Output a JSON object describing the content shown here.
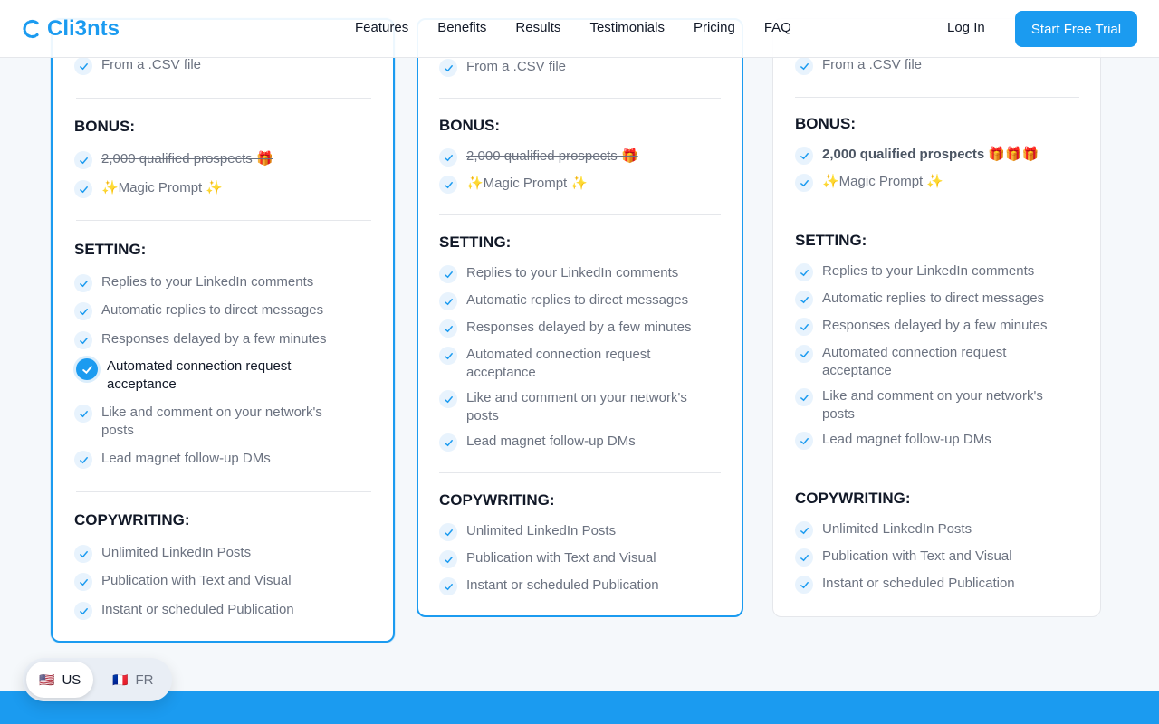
{
  "brand": {
    "name": "Cli3nts",
    "color": "#1b9bf0"
  },
  "nav": [
    "Features",
    "Benefits",
    "Results",
    "Testimonials",
    "Pricing",
    "FAQ"
  ],
  "header": {
    "login": "Log In",
    "cta": "Start Free Trial"
  },
  "cards": [
    {
      "top_item": "From a .CSV file",
      "bonus_title": "BONUS:",
      "bonus": [
        "2,000 qualified prospects 🎁",
        "✨Magic Prompt ✨"
      ],
      "setting_title": "SETTING:",
      "setting": [
        "Replies to your LinkedIn comments",
        "Automatic replies to direct messages",
        "Responses delayed by a few minutes",
        "Automated connection request acceptance",
        "Like and comment on your network's posts",
        "Lead magnet follow-up DMs"
      ],
      "copy_title": "COPYWRITING:",
      "copy": [
        "Unlimited LinkedIn Posts",
        "Publication with Text and Visual",
        "Instant or scheduled Publication"
      ]
    },
    {
      "top_item": "From a .CSV file",
      "bonus_title": "BONUS:",
      "bonus": [
        "2,000 qualified prospects 🎁",
        "✨Magic Prompt ✨"
      ],
      "setting_title": "SETTING:",
      "setting": [
        "Replies to your LinkedIn comments",
        "Automatic replies to direct messages",
        "Responses delayed by a few minutes",
        "Automated connection request acceptance",
        "Like and comment on your network's posts",
        "Lead magnet follow-up DMs"
      ],
      "copy_title": "COPYWRITING:",
      "copy": [
        "Unlimited LinkedIn Posts",
        "Publication with Text and Visual",
        "Instant or scheduled Publication"
      ]
    },
    {
      "top_item": "From a .CSV file",
      "bonus_title": "BONUS:",
      "bonus": [
        "2,000 qualified prospects 🎁🎁🎁",
        "✨Magic Prompt ✨"
      ],
      "setting_title": "SETTING:",
      "setting": [
        "Replies to your LinkedIn comments",
        "Automatic replies to direct messages",
        "Responses delayed by a few minutes",
        "Automated connection request acceptance",
        "Like and comment on your network's posts",
        "Lead magnet follow-up DMs"
      ],
      "copy_title": "COPYWRITING:",
      "copy": [
        "Unlimited LinkedIn Posts",
        "Publication with Text and Visual",
        "Instant or scheduled Publication"
      ]
    }
  ],
  "language": {
    "us": "US",
    "fr": "FR",
    "us_flag": "🇺🇸",
    "fr_flag": "🇫🇷"
  }
}
